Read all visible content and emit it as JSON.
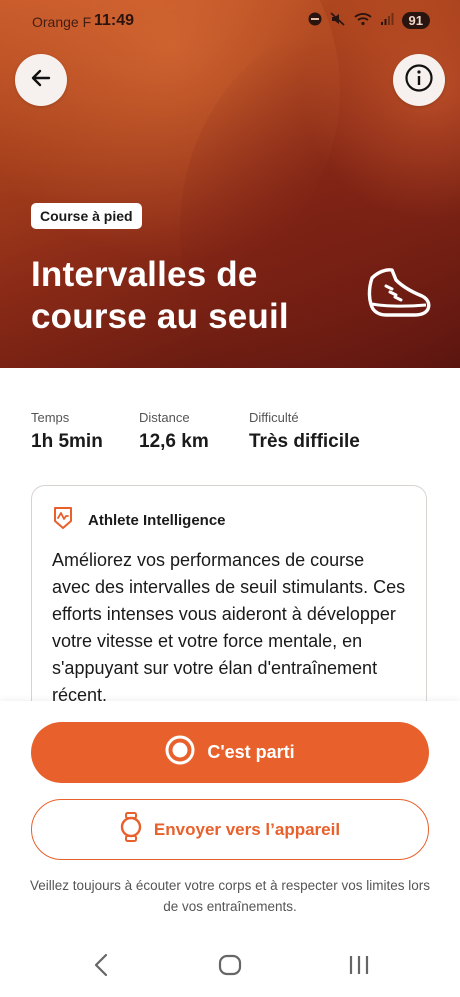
{
  "status_bar": {
    "carrier": "Orange F",
    "time": "11:49",
    "battery": "91",
    "icons": [
      "do-not-disturb-icon",
      "mute-icon",
      "wifi-icon",
      "signal-icon"
    ]
  },
  "header": {
    "back_icon": "arrow-left-icon",
    "info_icon": "info-icon",
    "tag": "Course à pied",
    "title": "Intervalles de course au seuil",
    "activity_icon": "running-shoe-icon"
  },
  "stats": [
    {
      "label": "Temps",
      "value": "1h 5min"
    },
    {
      "label": "Distance",
      "value": "12,6 km"
    },
    {
      "label": "Difficulté",
      "value": "Très difficile"
    }
  ],
  "insight_card": {
    "icon": "athlete-intelligence-icon",
    "title": "Athlete Intelligence",
    "body": "Améliorez vos performances de course avec des intervalles de seuil stimulants. Ces efforts intenses vous aideront à développer votre vitesse et votre force mentale, en s'appuyant sur votre élan d'entraînement récent."
  },
  "actions": {
    "primary_label": "C'est parti",
    "secondary_label": "Envoyer vers l’appareil"
  },
  "disclaimer": "Veillez toujours à écouter votre corps et à respecter vos limites lors de vos entraînements.",
  "colors": {
    "accent": "#e8612c",
    "hero_dark": "#6e1d12",
    "hero_light": "#c85a2a"
  },
  "nav_bar": {
    "items": [
      "back-nav-icon",
      "home-nav-icon",
      "recents-nav-icon"
    ]
  }
}
